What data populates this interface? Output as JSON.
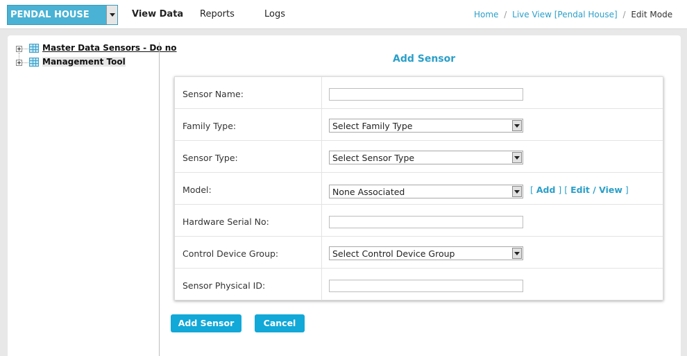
{
  "header": {
    "site_selector": {
      "value": "PENDAL HOUSE"
    },
    "nav": [
      {
        "label": "View Data",
        "active": true
      },
      {
        "label": "Reports",
        "active": false
      },
      {
        "label": "Logs",
        "active": false
      }
    ],
    "breadcrumb": {
      "home": "Home",
      "sep": "/",
      "live_view": "Live View [Pendal House]",
      "current": "Edit Mode"
    }
  },
  "tree": {
    "items": [
      {
        "label": "Master Data Sensors - Do no",
        "icon": "grid-icon"
      },
      {
        "label": "Management Tool",
        "icon": "grid-icon"
      }
    ]
  },
  "form": {
    "title": "Add Sensor",
    "rows": [
      {
        "label": "Sensor Name:",
        "type": "text",
        "value": ""
      },
      {
        "label": "Family Type:",
        "type": "select",
        "value": "Select Family Type"
      },
      {
        "label": "Sensor Type:",
        "type": "select",
        "value": "Select Sensor Type"
      },
      {
        "label": "Model:",
        "type": "select",
        "value": "None Associated"
      },
      {
        "label": "Hardware Serial No:",
        "type": "text",
        "value": ""
      },
      {
        "label": "Control Device Group:",
        "type": "select",
        "value": "Select Control Device Group"
      },
      {
        "label": "Sensor Physical ID:",
        "type": "text",
        "value": ""
      }
    ],
    "model_links": {
      "open1": "[ ",
      "add": "Add",
      "mid": " ] [ ",
      "edit_view": "Edit / View",
      "close": " ]"
    },
    "buttons": {
      "add_sensor": "Add Sensor",
      "cancel": "Cancel"
    }
  },
  "colors": {
    "accent": "#12a8d8",
    "link": "#2a9fc9",
    "site_selector_bg": "#4ab2d4"
  }
}
